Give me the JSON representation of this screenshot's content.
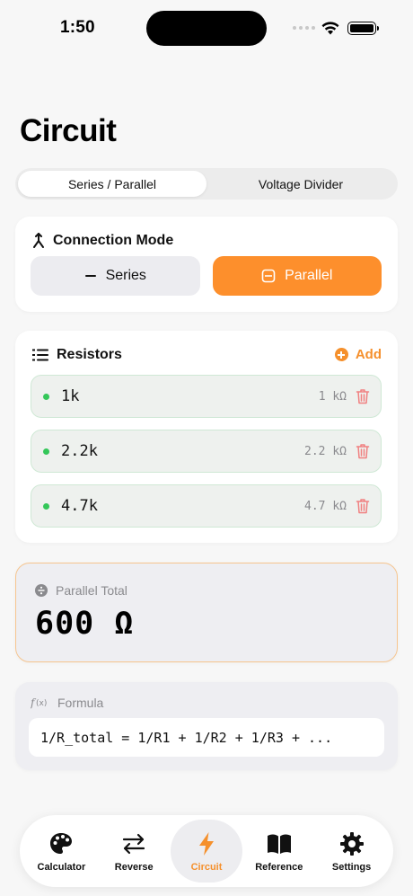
{
  "status_bar": {
    "time": "1:50"
  },
  "page": {
    "title": "Circuit"
  },
  "segmented_control": {
    "options": [
      "Series / Parallel",
      "Voltage Divider"
    ],
    "selected": "Series / Parallel"
  },
  "connection_mode": {
    "label": "Connection Mode",
    "options": [
      "Series",
      "Parallel"
    ],
    "selected": "Parallel"
  },
  "resistors": {
    "label": "Resistors",
    "add_label": "Add",
    "items": [
      {
        "name": "1k",
        "value": "1 kΩ"
      },
      {
        "name": "2.2k",
        "value": "2.2 kΩ"
      },
      {
        "name": "4.7k",
        "value": "4.7 kΩ"
      }
    ]
  },
  "total": {
    "label": "Parallel Total",
    "value": "600 Ω"
  },
  "formula": {
    "label": "Formula",
    "text": "1/R_total = 1/R1 + 1/R2 + 1/R3 + ..."
  },
  "tab_bar": {
    "tabs": [
      {
        "label": "Calculator",
        "icon": "palette-icon"
      },
      {
        "label": "Reverse",
        "icon": "swap-arrows-icon"
      },
      {
        "label": "Circuit",
        "icon": "bolt-icon"
      },
      {
        "label": "Reference",
        "icon": "book-icon"
      },
      {
        "label": "Settings",
        "icon": "gear-icon"
      }
    ],
    "selected": "Circuit"
  },
  "colors": {
    "accent": "#F5902C",
    "active_button": "#FD8F2C",
    "status_dot": "#34C759",
    "delete": "#F08080"
  }
}
